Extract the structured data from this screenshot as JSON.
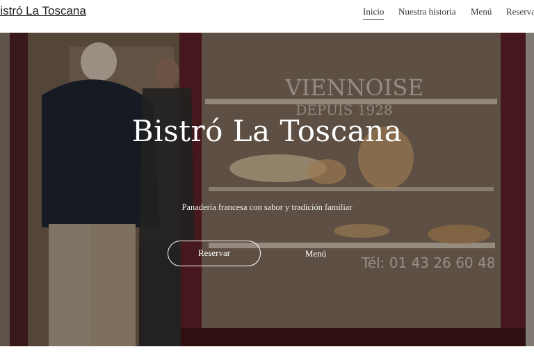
{
  "header": {
    "brand": "Bistró La Toscana",
    "nav": [
      {
        "label": "Inicio",
        "active": true
      },
      {
        "label": "Nuestra historia"
      },
      {
        "label": "Menú"
      },
      {
        "label": "Reservar"
      }
    ]
  },
  "hero": {
    "title": "Bistró La Toscana",
    "subtitle": "Panadería francesa con sabor y tradición familiar",
    "buttons": {
      "reserve": "Reservar",
      "menu": "Menú"
    },
    "photo_text": {
      "sign": "VIENNOISE",
      "since": "DEPUIS 1928",
      "phone": "Tél: 01 43 26 60 48"
    }
  },
  "colors": {
    "text_dark": "#333333",
    "hero_text": "#ffffff"
  }
}
